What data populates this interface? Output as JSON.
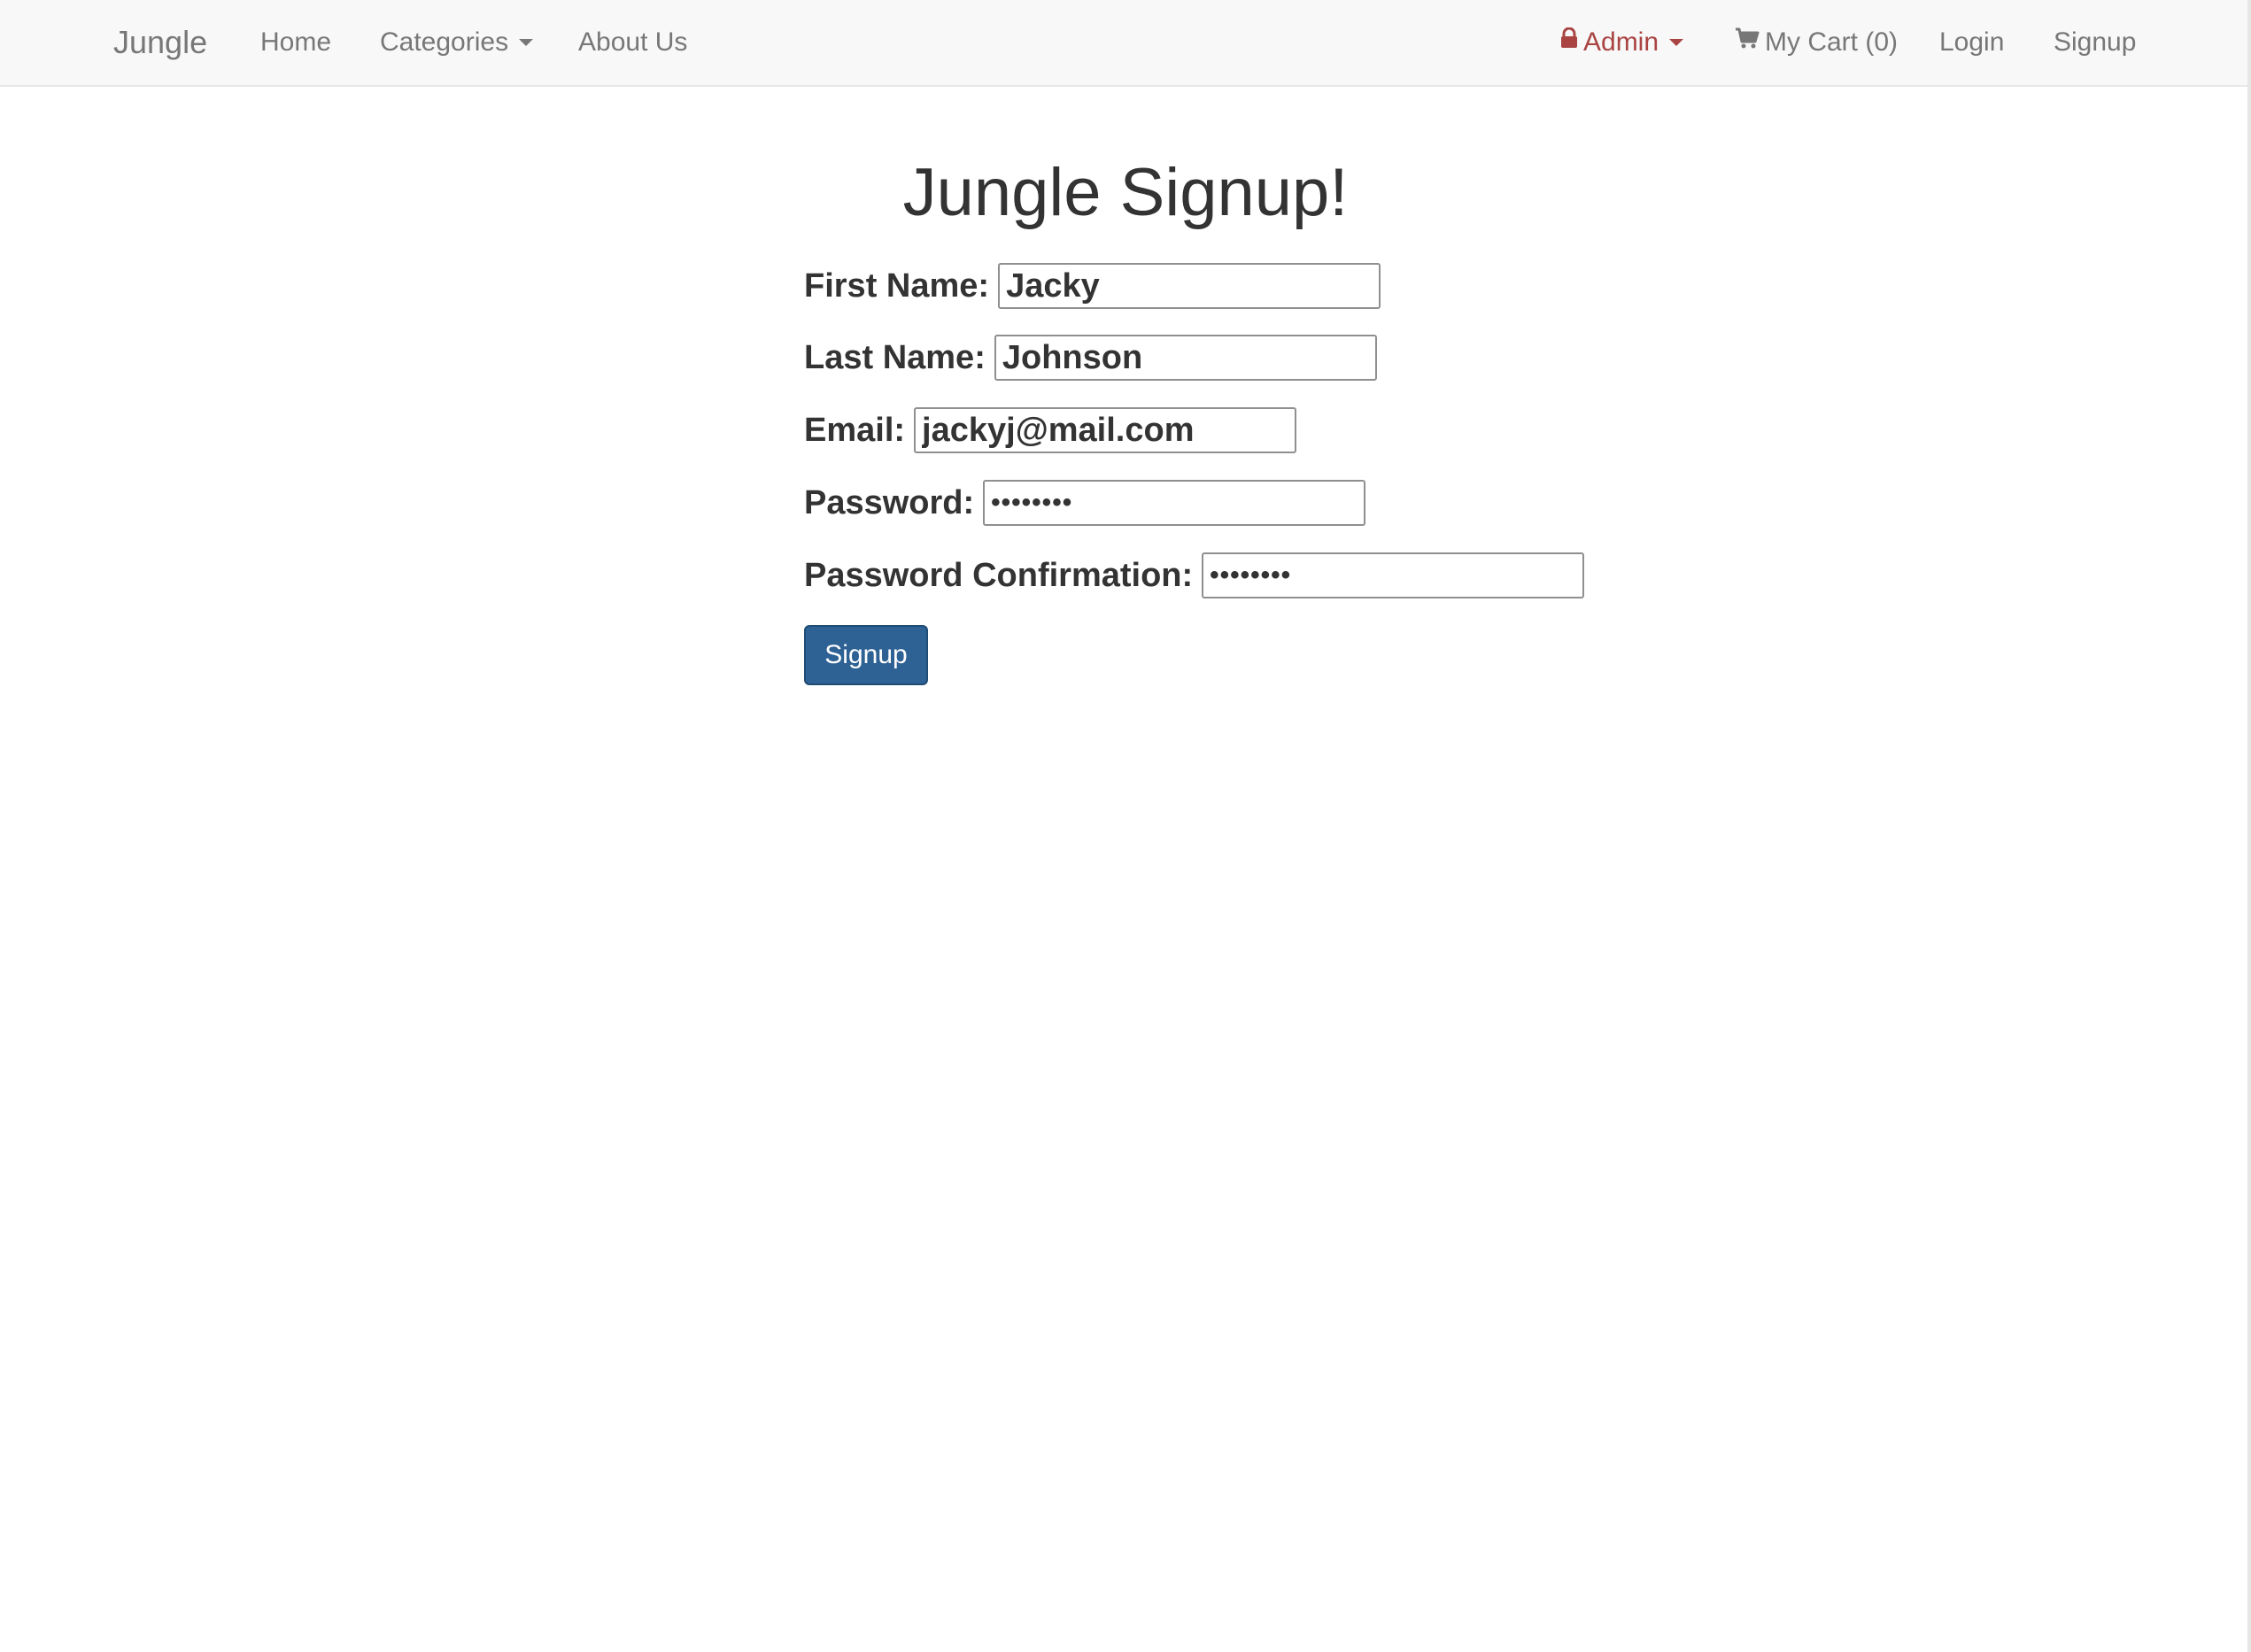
{
  "nav": {
    "brand": "Jungle",
    "home": "Home",
    "categories": "Categories",
    "about": "About Us",
    "admin": "Admin",
    "cart": "My Cart (0)",
    "login": "Login",
    "signup": "Signup"
  },
  "page": {
    "title": "Jungle Signup!"
  },
  "form": {
    "first_name_label": "First Name:",
    "first_name_value": "Jacky",
    "last_name_label": "Last Name:",
    "last_name_value": "Johnson",
    "email_label": "Email:",
    "email_value": "jackyj@mail.com",
    "password_label": "Password:",
    "password_value": "••••••••",
    "password_confirmation_label": "Password Confirmation:",
    "password_confirmation_value": "••••••••",
    "submit_label": "Signup"
  },
  "icons": {
    "admin": "lock-icon",
    "cart": "shopping-cart-icon",
    "dropdown": "caret-down-icon"
  },
  "colors": {
    "navbar_bg": "#f8f8f8",
    "nav_text": "#777777",
    "admin_text": "#a94442",
    "button_bg": "#2e6194",
    "text": "#333333"
  }
}
